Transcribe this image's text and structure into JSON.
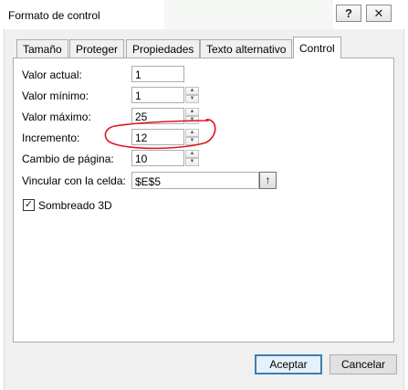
{
  "window": {
    "title": "Formato de control",
    "help_glyph": "?",
    "close_glyph": "✕"
  },
  "tabs": [
    {
      "label": "Tamaño",
      "active": false
    },
    {
      "label": "Proteger",
      "active": false
    },
    {
      "label": "Propiedades",
      "active": false
    },
    {
      "label": "Texto alternativo",
      "active": false
    },
    {
      "label": "Control",
      "active": true
    }
  ],
  "fields": {
    "valor_actual": {
      "label": "Valor actual:",
      "value": "1"
    },
    "valor_minimo": {
      "label": "Valor mínimo:",
      "value": "1"
    },
    "valor_maximo": {
      "label": "Valor máximo:",
      "value": "25"
    },
    "incremento": {
      "label": "Incremento:",
      "value": "12"
    },
    "cambio_pagina": {
      "label": "Cambio de página:",
      "value": "10"
    },
    "vincular": {
      "label": "Vincular con la celda:",
      "value": "$E$5",
      "button_glyph": "↑"
    }
  },
  "spinner": {
    "up": "▲",
    "down": "▼"
  },
  "sombreado": {
    "label": "Sombreado 3D",
    "checked": true,
    "mark": "✓"
  },
  "buttons": {
    "accept": "Aceptar",
    "cancel": "Cancelar"
  },
  "colors": {
    "annotation": "#e0141e",
    "default_button_border": "#3c7fb1"
  }
}
